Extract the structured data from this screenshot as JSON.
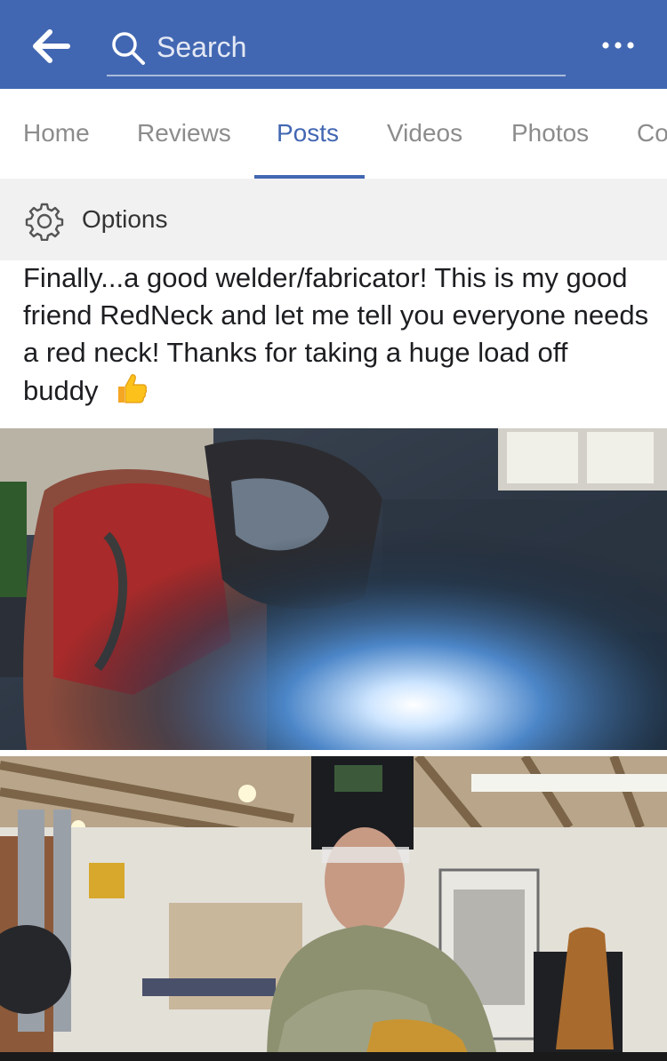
{
  "header": {
    "search_placeholder": "Search",
    "back_icon": "arrow-left-icon",
    "more_icon": "more-horizontal-icon",
    "bar_color": "#4267b2"
  },
  "tabs": [
    {
      "label": "Home",
      "active": false
    },
    {
      "label": "Reviews",
      "active": false
    },
    {
      "label": "Posts",
      "active": true
    },
    {
      "label": "Videos",
      "active": false
    },
    {
      "label": "Photos",
      "active": false
    },
    {
      "label": "Co",
      "active": false
    }
  ],
  "options": {
    "label": "Options",
    "icon": "gear-icon"
  },
  "post": {
    "text": "Finally...a good welder/fabricator! This is my good friend RedNeck and let me tell you everyone needs a red neck! Thanks for taking a huge load off buddy",
    "emoji": "thumbs-up-icon"
  },
  "photos": [
    {
      "description_icon": "photo-welding"
    },
    {
      "description_icon": "photo-garage-portrait"
    }
  ]
}
